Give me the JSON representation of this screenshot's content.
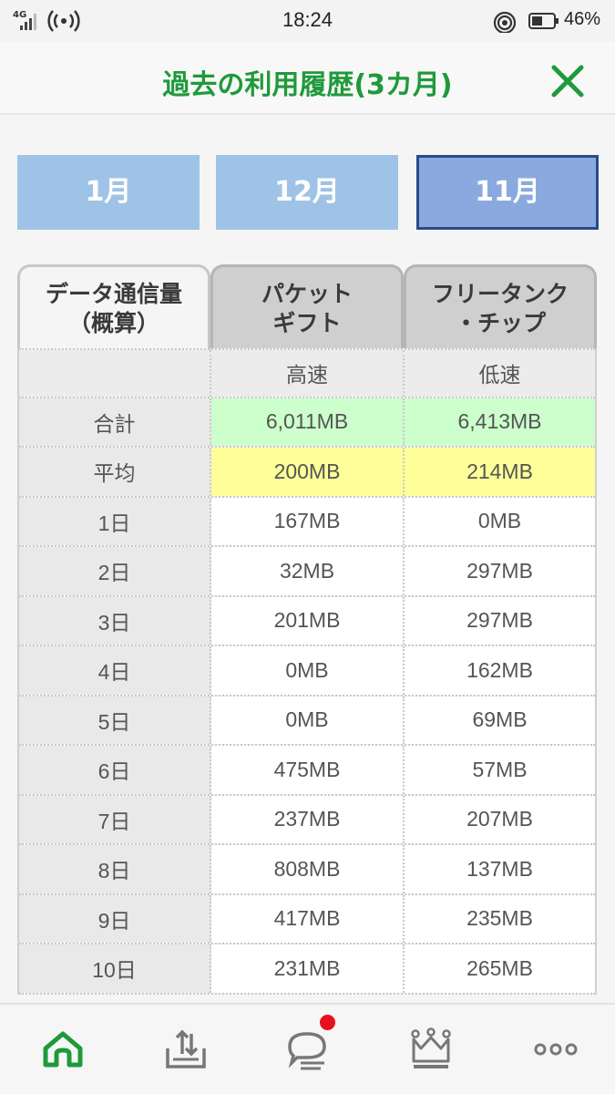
{
  "status_bar": {
    "network": "4G",
    "time": "18:24",
    "battery": "46%"
  },
  "header": {
    "title": "過去の利用履歴(3カ月)"
  },
  "months": [
    "1月",
    "12月",
    "11月"
  ],
  "selected_month": "11月",
  "table_tabs": {
    "data_usage": [
      "データ通信量",
      "（概算）"
    ],
    "packet_gift": [
      "パケット",
      "ギフト"
    ],
    "free_tank": [
      "フリータンク",
      "・チップ"
    ]
  },
  "table": {
    "col_headers": [
      "",
      "高速",
      "低速"
    ],
    "total": {
      "label": "合計",
      "high": "6,011MB",
      "low": "6,413MB"
    },
    "average": {
      "label": "平均",
      "high": "200MB",
      "low": "214MB"
    },
    "rows": [
      {
        "day": "1日",
        "high": "167MB",
        "low": "0MB"
      },
      {
        "day": "2日",
        "high": "32MB",
        "low": "297MB"
      },
      {
        "day": "3日",
        "high": "201MB",
        "low": "297MB"
      },
      {
        "day": "4日",
        "high": "0MB",
        "low": "162MB"
      },
      {
        "day": "5日",
        "high": "0MB",
        "low": "69MB"
      },
      {
        "day": "6日",
        "high": "475MB",
        "low": "57MB"
      },
      {
        "day": "7日",
        "high": "237MB",
        "low": "207MB"
      },
      {
        "day": "8日",
        "high": "808MB",
        "low": "137MB"
      },
      {
        "day": "9日",
        "high": "417MB",
        "low": "235MB"
      },
      {
        "day": "10日",
        "high": "231MB",
        "low": "265MB"
      }
    ]
  },
  "colors": {
    "accent_green": "#1f9a3b",
    "month_tab": "#9fc3e6",
    "month_tab_selected": "#8aa9de",
    "total_bg": "#ccffcc",
    "average_bg": "#ffff99",
    "badge_red": "#e8101c"
  },
  "icons": {
    "close": "close-icon",
    "nav": [
      "home-icon",
      "upload-icon",
      "chat-icon",
      "crown-icon",
      "more-icon"
    ]
  }
}
